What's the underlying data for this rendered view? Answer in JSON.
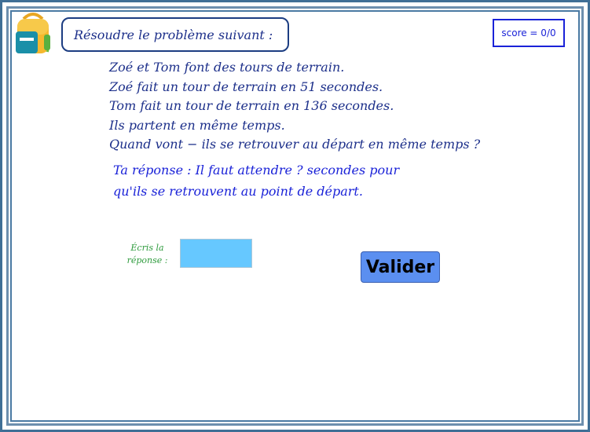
{
  "header": {
    "title": "Résoudre le problème suivant :",
    "score": "score = 0/0"
  },
  "problem": {
    "lines": [
      "Zoé et Tom font des tours de terrain.",
      "Zoé fait un tour de terrain en 51 secondes.",
      "Tom fait un tour de terrain en 136 secondes.",
      "Ils partent en même temps.",
      "Quand vont − ils se retrouver au départ en même temps ?"
    ]
  },
  "answer": {
    "lines": [
      "Ta réponse : Il faut attendre ? secondes pour",
      "qu'ils se retrouvent au point de départ."
    ]
  },
  "form": {
    "prompt_line1": "Écris la",
    "prompt_line2": "réponse :",
    "input_value": "",
    "submit_label": "Valider"
  },
  "icons": {
    "logo": "backpack-icon"
  },
  "colors": {
    "border": "#3f6f96",
    "text_dark_blue": "#1c2f8a",
    "text_blue": "#1a22d8",
    "prompt_green": "#2e9b3d",
    "input_bg": "#66c8ff",
    "button_bg": "#5b8ff0"
  }
}
